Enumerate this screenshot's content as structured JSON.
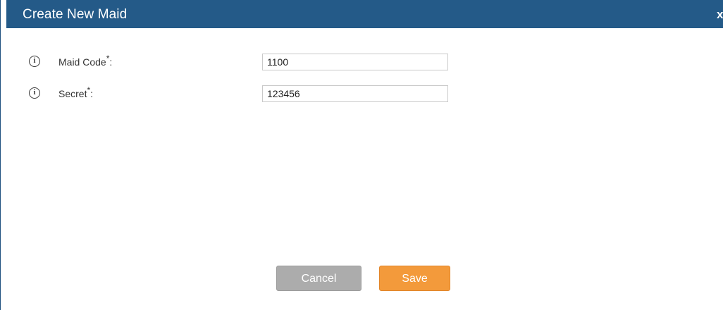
{
  "dialog": {
    "title": "Create New Maid",
    "close_label": "x"
  },
  "fields": [
    {
      "icon": "info-icon",
      "label": "Maid Code",
      "required_mark": "*",
      "suffix": ":",
      "value": "1100"
    },
    {
      "icon": "info-icon",
      "label": "Secret",
      "required_mark": "*",
      "suffix": ":",
      "value": "123456"
    }
  ],
  "buttons": {
    "cancel_label": "Cancel",
    "save_label": "Save"
  },
  "colors": {
    "titlebar": "#245a88",
    "cancel": "#acacac",
    "save": "#f39a3b"
  }
}
